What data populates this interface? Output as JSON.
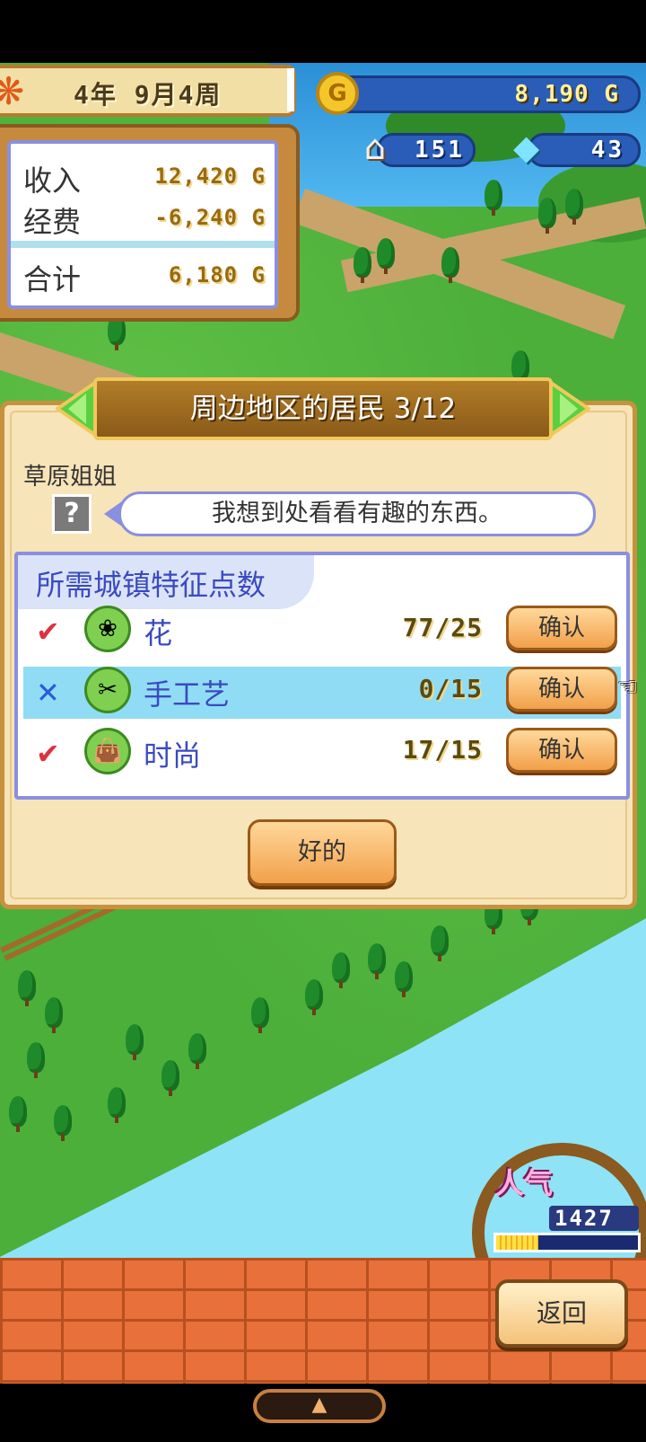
{
  "header": {
    "date": "4年 9月4周",
    "gold": "8,190 G",
    "population": "151",
    "gems": "43"
  },
  "finance": {
    "income_label": "收入",
    "income_value": "12,420 G",
    "expense_label": "经费",
    "expense_value": "-6,240 G",
    "total_label": "合计",
    "total_value": "6,180 G"
  },
  "dialog": {
    "title": "周边地区的居民 3/12",
    "resident_name": "草原姐姐",
    "portrait_placeholder": "?",
    "speech": "我想到处看看有趣的东西。",
    "requirements_title": "所需城镇特征点数",
    "requirements": [
      {
        "status": "✔",
        "icon": "flower-icon",
        "label": "花",
        "value": "77/25",
        "button": "确认",
        "met": true
      },
      {
        "status": "✕",
        "icon": "craft-icon",
        "label": "手工艺",
        "value": "0/15",
        "button": "确认",
        "met": false
      },
      {
        "status": "✔",
        "icon": "fashion-icon",
        "label": "时尚",
        "value": "17/15",
        "button": "确认",
        "met": true
      }
    ],
    "ok_button": "好的"
  },
  "popularity": {
    "label": "人气",
    "value": "1427",
    "level": 0.3
  },
  "footer": {
    "back_button": "返回",
    "nav_arrow": "▲"
  },
  "colors": {
    "accent_blue": "#3a4ac0",
    "check_red": "#e03040",
    "cross_blue": "#2a5ad8",
    "highlight_row": "#8fdcf4"
  }
}
